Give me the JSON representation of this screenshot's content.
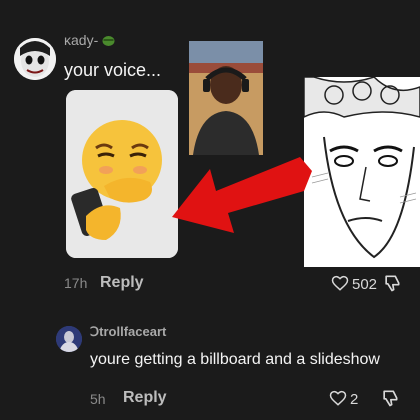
{
  "comments": [
    {
      "username": "ĸady-",
      "username_emoji_icon": "sick-face-emoji",
      "text": "your voice...",
      "time": "17h",
      "reply_label": "Reply",
      "likes": "502"
    },
    {
      "username": "Ↄtrollfaceart",
      "text": "youre getting a billboard and a slideshow",
      "time": "5h",
      "reply_label": "Reply",
      "likes": "2"
    }
  ],
  "icons": {
    "like": "heart-outline-icon",
    "dislike": "thumbs-down-outline-icon"
  },
  "colors": {
    "background": "#1b1b1b",
    "arrow": "#e01212",
    "emoji_yellow": "#f6c33c"
  }
}
